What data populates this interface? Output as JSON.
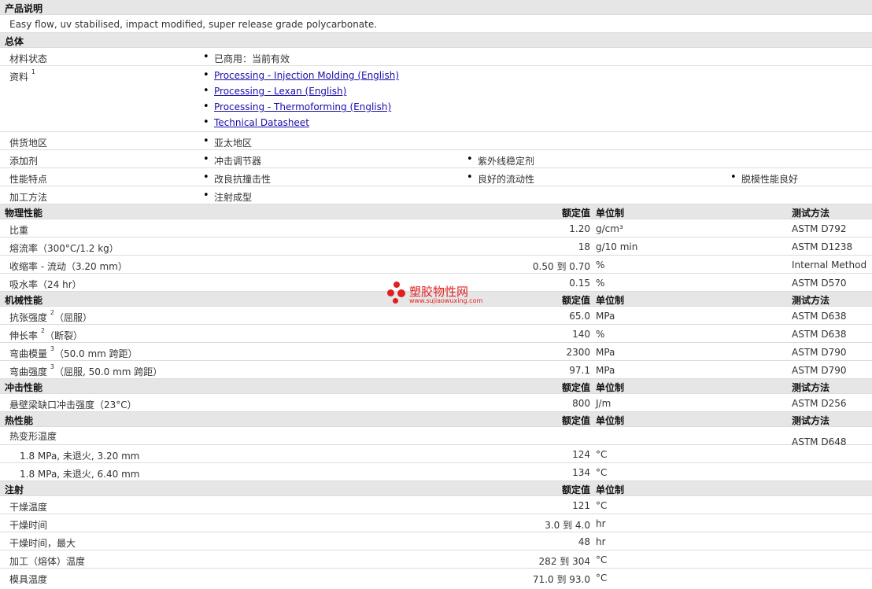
{
  "desc_header": "产品说明",
  "description": "Easy flow, uv stabilised, impact modified, super release grade polycarbonate.",
  "general": {
    "header": "总体",
    "status_label": "材料状态",
    "status_value": "已商用：当前有效",
    "docs_label": "资料",
    "docs_sup": "1",
    "docs": [
      "Processing - Injection Molding (English)",
      "Processing - Lexan (English)",
      "Processing - Thermoforming (English)",
      "Technical Datasheet"
    ],
    "region_label": "供货地区",
    "region_value": "亚太地区",
    "additive_label": "添加剂",
    "additives": [
      "冲击调节器",
      "紫外线稳定剂"
    ],
    "features_label": "性能特点",
    "features": [
      "改良抗撞击性",
      "良好的流动性",
      "脱模性能良好"
    ],
    "process_label": "加工方法",
    "process_value": "注射成型"
  },
  "headers": {
    "nominal": "额定值",
    "unit": "单位制",
    "method": "测试方法"
  },
  "physical": {
    "title": "物理性能",
    "rows": [
      {
        "label": "比重",
        "value": "1.20",
        "unit": "g/cm³",
        "method": "ASTM D792"
      },
      {
        "label": "熔流率（300°C/1.2 kg）",
        "value": "18",
        "unit": "g/10 min",
        "method": "ASTM D1238"
      },
      {
        "label": "收缩率 - 流动（3.20 mm）",
        "value": "0.50 到  0.70",
        "unit": "%",
        "method": "Internal Method"
      },
      {
        "label": "吸水率（24 hr）",
        "value": "0.15",
        "unit": "%",
        "method": "ASTM D570"
      }
    ]
  },
  "mechanical": {
    "title": "机械性能",
    "rows": [
      {
        "label": "抗张强度",
        "sup": "2",
        "label2": "（屈服）",
        "value": "65.0",
        "unit": "MPa",
        "method": "ASTM D638"
      },
      {
        "label": "伸长率",
        "sup": "2",
        "label2": "（断裂）",
        "value": "140",
        "unit": "%",
        "method": "ASTM D638"
      },
      {
        "label": "弯曲模量",
        "sup": "3",
        "label2": "（50.0 mm 跨距）",
        "value": "2300",
        "unit": "MPa",
        "method": "ASTM D790"
      },
      {
        "label": "弯曲强度",
        "sup": "3",
        "label2": "（屈服, 50.0 mm 跨距）",
        "value": "97.1",
        "unit": "MPa",
        "method": "ASTM D790"
      }
    ]
  },
  "impact": {
    "title": "冲击性能",
    "rows": [
      {
        "label": "悬壁梁缺口冲击强度（23°C）",
        "value": "800",
        "unit": "J/m",
        "method": "ASTM D256"
      }
    ]
  },
  "thermal": {
    "title": "热性能",
    "hdt_label": "热变形温度",
    "hdt_method": "ASTM D648",
    "rows": [
      {
        "label": "1.8 MPa, 未退火, 3.20 mm",
        "value": "124",
        "unit": "°C"
      },
      {
        "label": "1.8 MPa, 未退火, 6.40 mm",
        "value": "134",
        "unit": "°C"
      }
    ]
  },
  "injection": {
    "title": "注射",
    "rows": [
      {
        "label": "干燥温度",
        "value": "121",
        "unit": "°C"
      },
      {
        "label": "干燥时间",
        "value": "3.0 到  4.0",
        "unit": "hr"
      },
      {
        "label": "干燥时间，最大",
        "value": "48",
        "unit": "hr"
      },
      {
        "label": "加工（熔体）温度",
        "value": "282 到  304",
        "unit": "°C"
      },
      {
        "label": "模具温度",
        "value": "71.0 到  93.0",
        "unit": "°C"
      }
    ]
  },
  "watermark": {
    "text": "塑胶物性网",
    "url": "www.sujiaowuxing.com"
  }
}
